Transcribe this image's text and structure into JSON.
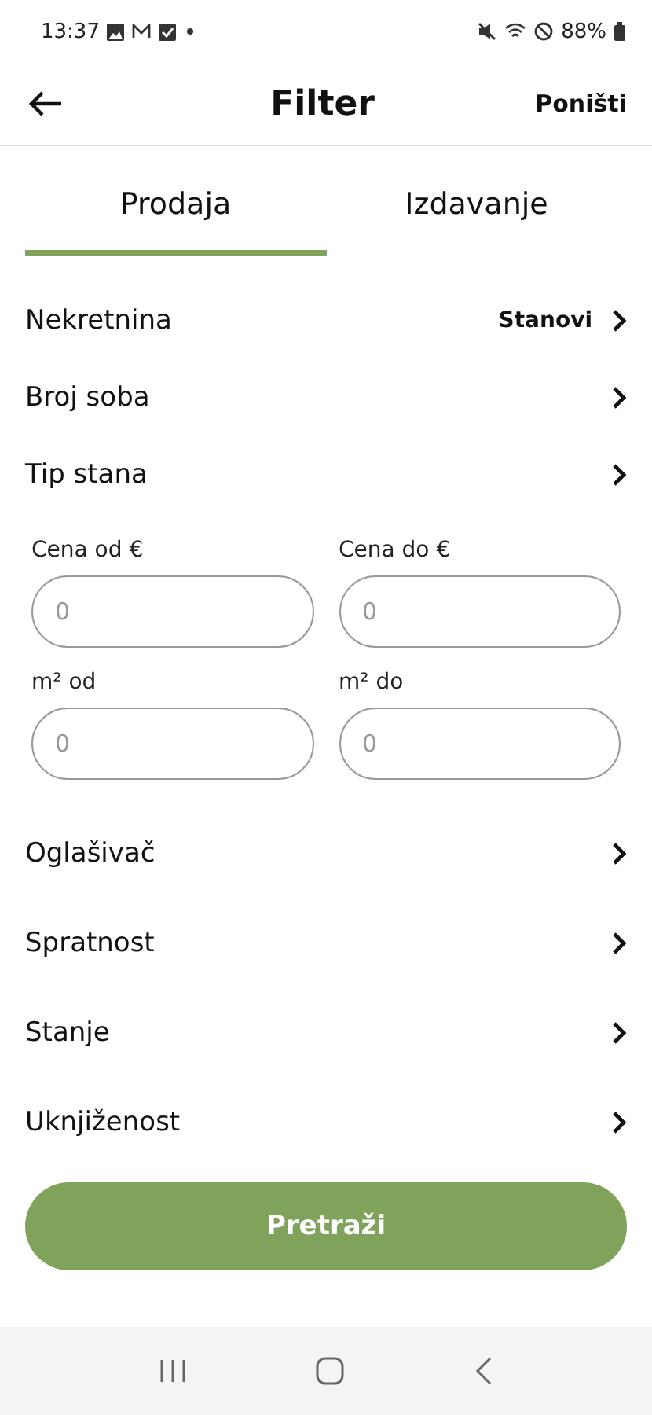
{
  "status_bar": {
    "time": "13:37",
    "battery": "88%"
  },
  "header": {
    "title": "Filter",
    "action": "Poništi"
  },
  "tabs": [
    {
      "label": "Prodaja",
      "selected": true
    },
    {
      "label": "Izdavanje",
      "selected": false
    }
  ],
  "filters_top": [
    {
      "label": "Nekretnina",
      "value": "Stanovi"
    },
    {
      "label": "Broj soba"
    },
    {
      "label": "Tip stana"
    }
  ],
  "range_fields": [
    {
      "label": "Cena od €",
      "placeholder": "0"
    },
    {
      "label": "Cena do €",
      "placeholder": "0"
    },
    {
      "label": "m² od",
      "placeholder": "0"
    },
    {
      "label": "m² do",
      "placeholder": "0"
    }
  ],
  "filters_bottom": [
    {
      "label": "Oglašivač"
    },
    {
      "label": "Spratnost"
    },
    {
      "label": "Stanje"
    },
    {
      "label": "Uknjiženost"
    }
  ],
  "search_button": "Pretraži"
}
